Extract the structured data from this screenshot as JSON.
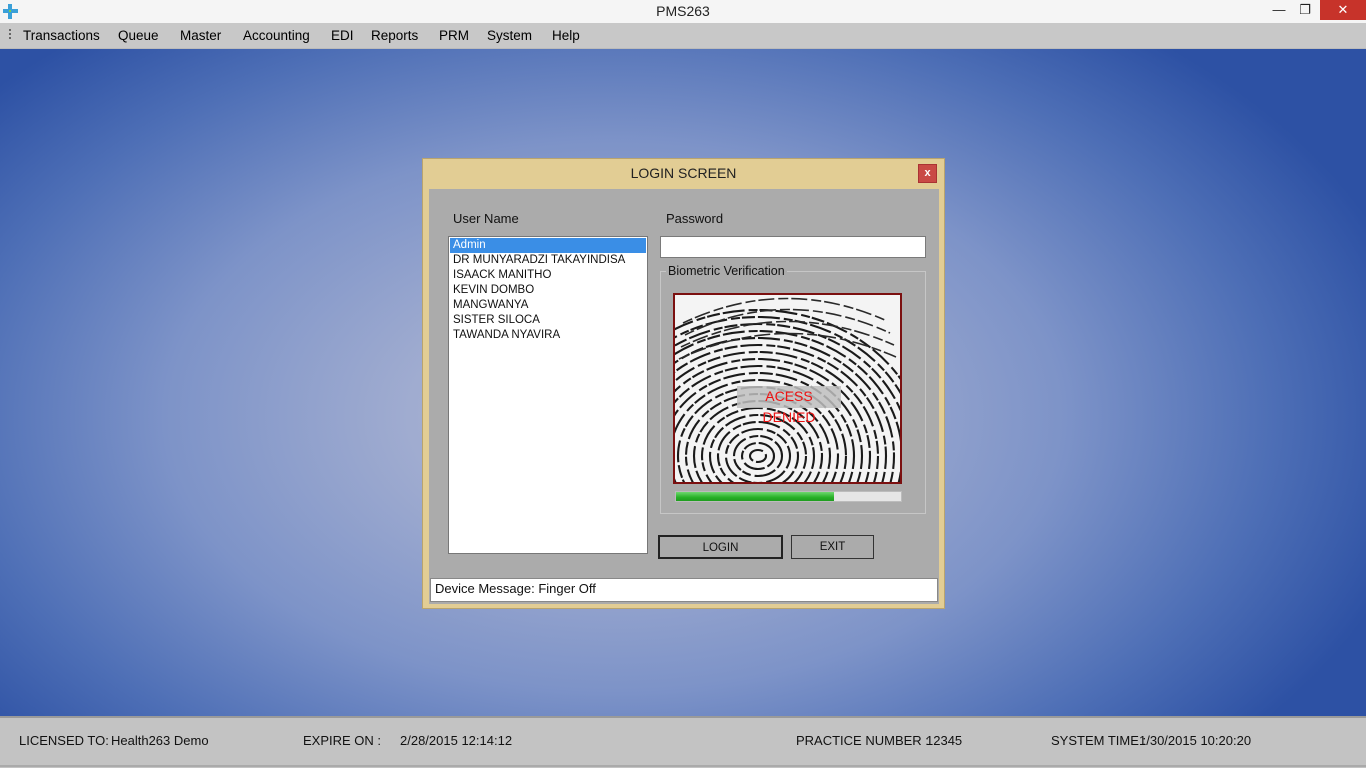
{
  "window": {
    "title": "PMS263",
    "minimize_glyph": "—",
    "maximize_glyph": "❐",
    "close_glyph": "✕",
    "icon": "medical-cross-icon"
  },
  "menu": {
    "items": [
      "Transactions",
      "Queue",
      "Master",
      "Accounting",
      "EDI",
      "Reports",
      "PRM",
      "System",
      "Help"
    ]
  },
  "login": {
    "title": "LOGIN SCREEN",
    "close_glyph": "x",
    "username_label": "User Name",
    "password_label": "Password",
    "password_value": "",
    "users": [
      "Admin",
      "DR MUNYARADZI TAKAYINDISA",
      "ISAACK MANITHO",
      "KEVIN DOMBO",
      "MANGWANYA",
      "SISTER SILOCA",
      "TAWANDA NYAVIRA"
    ],
    "selected_user": "Admin",
    "biometric_label": "Biometric Verification",
    "biometric_status": "ACESS DENIED",
    "scan_progress": 0.7,
    "login_button": "LOGIN",
    "exit_button": "EXIT",
    "device_message": "Device Message: Finger Off"
  },
  "status": {
    "licensed_label": "LICENSED TO:",
    "licensed_value": "Health263 Demo",
    "expire_label": "EXPIRE ON :",
    "expire_value": "2/28/2015 12:14:12",
    "practice_label": "PRACTICE NUMBER :",
    "practice_value": "12345",
    "systime_label": "SYSTEM TIME :",
    "systime_value": "1/30/2015 10:20:20"
  },
  "colors": {
    "dialog_frame": "#e2cd94",
    "dialog_body": "#ababab",
    "selection": "#3a8ee6",
    "denied_text": "#ee1111",
    "progress_fill": "#27b027",
    "desktop": "#2d51a4"
  }
}
